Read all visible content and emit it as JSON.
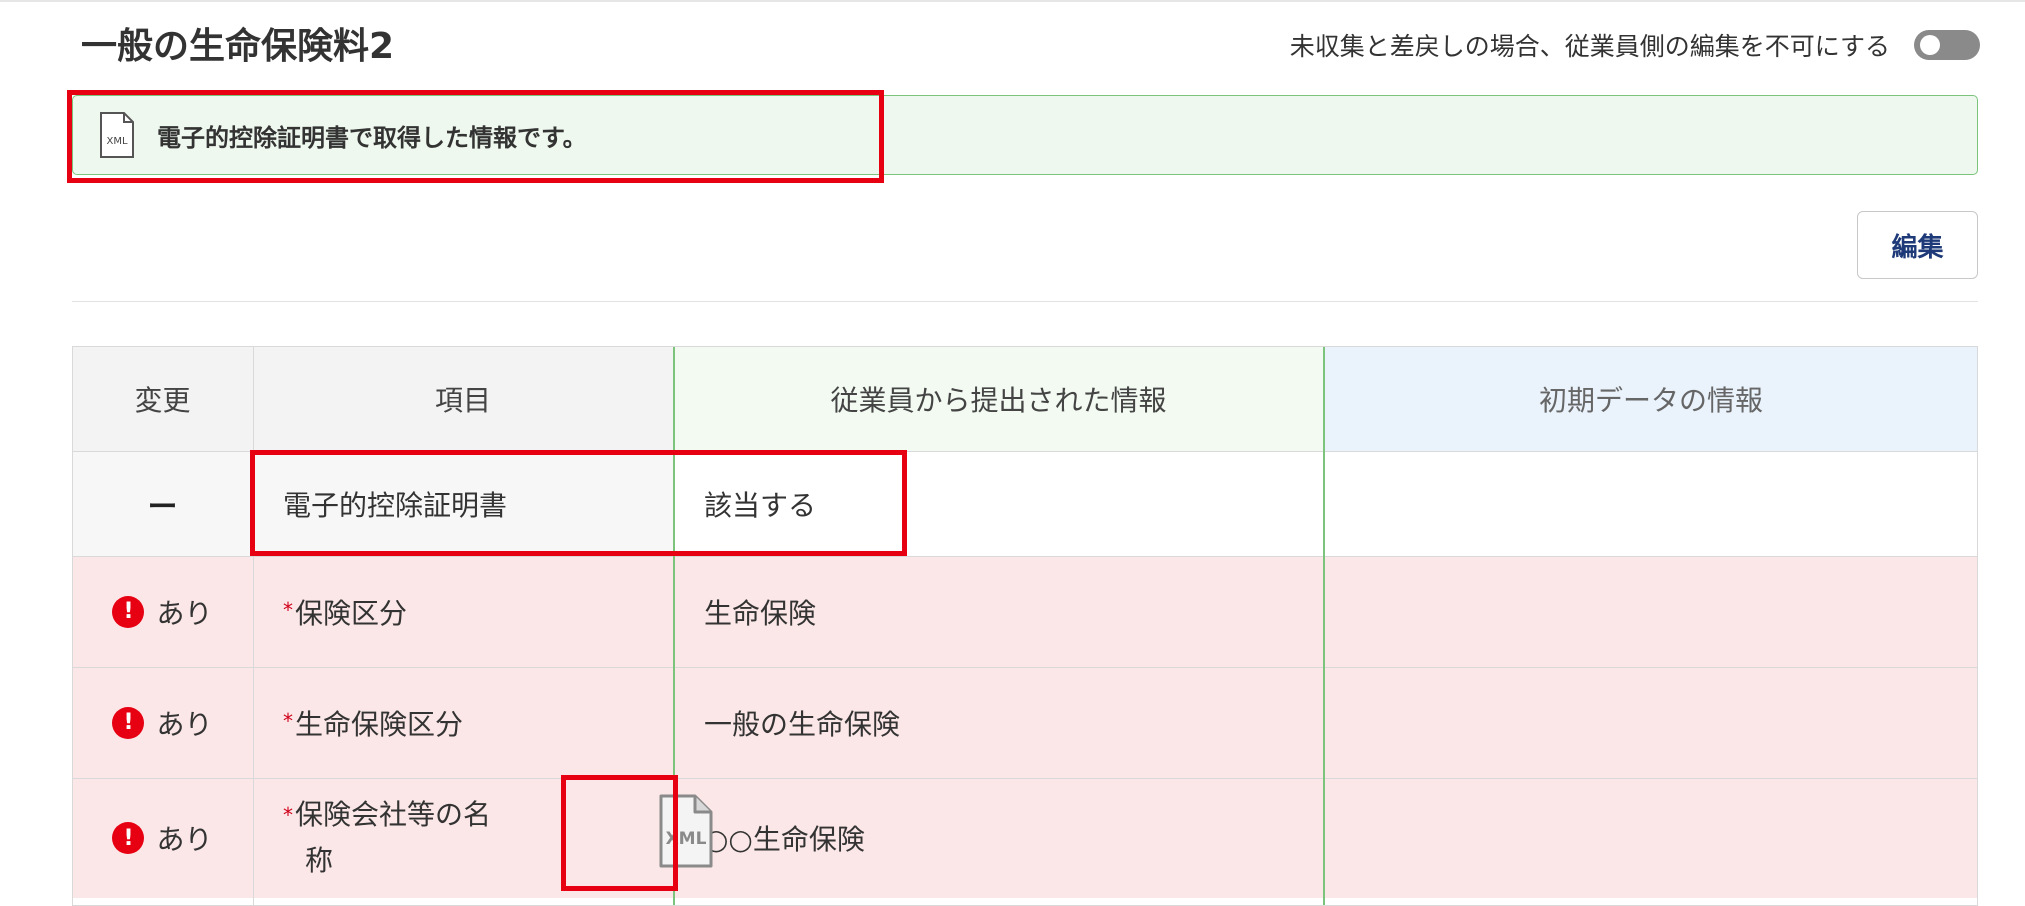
{
  "page": {
    "title": "一般の生命保険料2"
  },
  "toggle": {
    "label": "未収集と差戻しの場合、従業員側の編集を不可にする",
    "state": "off"
  },
  "banner": {
    "icon": "xml-file-icon",
    "text": "電子的控除証明書で取得した情報です。"
  },
  "actions": {
    "edit_label": "編集"
  },
  "table": {
    "headers": [
      "変更",
      "項目",
      "従業員から提出された情報",
      "初期データの情報"
    ],
    "rows": [
      {
        "change": "ー",
        "item": "電子的控除証明書",
        "employee_value": "該当する",
        "initial_value": ""
      },
      {
        "change": "あり",
        "item": "保険区分",
        "employee_value": "生命保険",
        "initial_value": ""
      },
      {
        "change": "あり",
        "item": "生命保険区分",
        "employee_value": "一般の生命保険",
        "initial_value": ""
      },
      {
        "change": "あり",
        "item_line1": "保険会社等の名",
        "item_line2": "称",
        "employee_value": "○○生命保険",
        "initial_value": ""
      }
    ],
    "required_mark": "*",
    "xml_icon_text": "XML"
  },
  "colors": {
    "highlight": "#e60012",
    "banner_bg": "#eef8ee",
    "banner_border": "#7cc47c",
    "changed_row_bg": "#fbe7e7",
    "initial_header_bg": "#eaf3fc"
  }
}
